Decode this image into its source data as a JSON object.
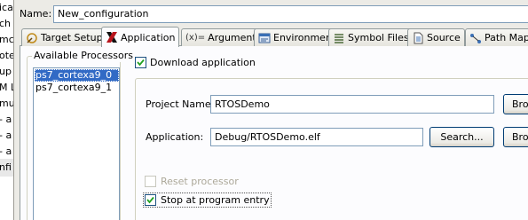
{
  "left_tree": {
    "items": [
      "ica",
      "ch",
      "mc",
      "ote",
      "up",
      "M L",
      "mu",
      "- a",
      "- a",
      "- a",
      "nfi"
    ]
  },
  "name_field": {
    "label": "Name:",
    "value": "New_configuration"
  },
  "tabs": [
    {
      "label": "Target Setup",
      "icon": "target-icon"
    },
    {
      "label": "Application",
      "icon": "xilinx-x-icon",
      "active": true
    },
    {
      "label": "Arguments",
      "icon": "arguments-icon"
    },
    {
      "label": "Environment",
      "icon": "environment-icon"
    },
    {
      "label": "Symbol Files",
      "icon": "symbol-files-icon"
    },
    {
      "label": "Source",
      "icon": "source-icon"
    },
    {
      "label": "Path Map",
      "icon": "path-map-icon"
    }
  ],
  "processors": {
    "title": "Available Processors",
    "items": [
      "ps7_cortexa9_0",
      "ps7_cortexa9_1"
    ],
    "selected_index": 0
  },
  "download_application": {
    "label": "Download application",
    "checked": true
  },
  "project": {
    "label": "Project Name:",
    "value": "RTOSDemo",
    "browse_label": "Bro"
  },
  "application": {
    "label": "Application:",
    "value": "Debug/RTOSDemo.elf",
    "search_label": "Search...",
    "browse_label": "Bro"
  },
  "reset_processor": {
    "label": "Reset processor",
    "checked": false,
    "enabled": false
  },
  "stop_at_entry": {
    "label": "Stop at program entry",
    "checked": true
  },
  "colors": {
    "selection": "#316ac5",
    "field_border": "#7f9db9",
    "panel_bg": "#fcfcfe",
    "window_bg": "#ecebe6"
  }
}
